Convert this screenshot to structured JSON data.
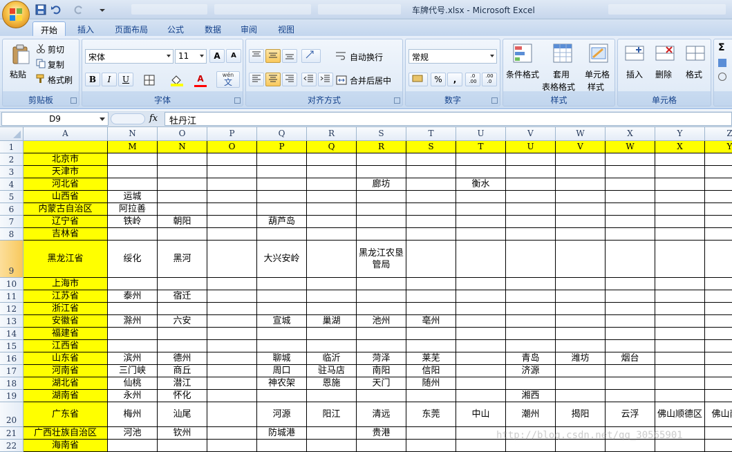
{
  "window": {
    "title": "车牌代号.xlsx - Microsoft Excel"
  },
  "ribbon_tabs": [
    "开始",
    "插入",
    "页面布局",
    "公式",
    "数据",
    "审阅",
    "视图"
  ],
  "clipboard": {
    "paste": "粘贴",
    "cut": "剪切",
    "copy": "复制",
    "format_painter": "格式刷",
    "label": "剪贴板"
  },
  "font": {
    "name": "宋体",
    "size": "11",
    "label": "字体",
    "bold": "B",
    "italic": "I",
    "underline": "U",
    "grow": "A",
    "shrink": "A",
    "font_color": "A",
    "phonetic": "wén",
    "phonetic_char": "文"
  },
  "alignment": {
    "wrap_text": "自动换行",
    "merge_center": "合并后居中",
    "label": "对齐方式"
  },
  "number": {
    "format": "常规",
    "percent": "%",
    "comma": ",",
    "inc_decimal": ".0 .00",
    "dec_decimal": ".00 .0",
    "label": "数字"
  },
  "styles": {
    "conditional": "条件格式",
    "table1": "套用",
    "table2": "表格格式",
    "cell1": "单元格",
    "cell2": "样式",
    "label": "样式"
  },
  "cells": {
    "insert": "插入",
    "delete": "删除",
    "format": "格式",
    "label": "单元格"
  },
  "editing": {
    "sum": "Σ"
  },
  "formula_bar": {
    "name_box": "D9",
    "fx": "fx",
    "content": "牡丹江"
  },
  "sheet": {
    "columns": [
      "A",
      "N",
      "O",
      "P",
      "Q",
      "R",
      "S",
      "T",
      "U",
      "V",
      "W",
      "X",
      "Y",
      "Z"
    ],
    "row1": [
      "",
      "M",
      "N",
      "O",
      "P",
      "Q",
      "R",
      "S",
      "T",
      "U",
      "V",
      "W",
      "X",
      "Y"
    ],
    "rows": [
      {
        "n": "2",
        "cells": [
          "北京市",
          "",
          "",
          "",
          "",
          "",
          "",
          "",
          "",
          "",
          "",
          "",
          "",
          ""
        ]
      },
      {
        "n": "3",
        "cells": [
          "天津市",
          "",
          "",
          "",
          "",
          "",
          "",
          "",
          "",
          "",
          "",
          "",
          "",
          ""
        ]
      },
      {
        "n": "4",
        "cells": [
          "河北省",
          "",
          "",
          "",
          "",
          "",
          "廊坊",
          "",
          "衡水",
          "",
          "",
          "",
          "",
          ""
        ]
      },
      {
        "n": "5",
        "cells": [
          "山西省",
          "运城",
          "",
          "",
          "",
          "",
          "",
          "",
          "",
          "",
          "",
          "",
          "",
          ""
        ]
      },
      {
        "n": "6",
        "cells": [
          "内蒙古自治区",
          "阿拉善",
          "",
          "",
          "",
          "",
          "",
          "",
          "",
          "",
          "",
          "",
          "",
          ""
        ]
      },
      {
        "n": "7",
        "cells": [
          "辽宁省",
          "铁岭",
          "朝阳",
          "",
          "葫芦岛",
          "",
          "",
          "",
          "",
          "",
          "",
          "",
          "",
          ""
        ]
      },
      {
        "n": "8",
        "cells": [
          "吉林省",
          "",
          "",
          "",
          "",
          "",
          "",
          "",
          "",
          "",
          "",
          "",
          "",
          ""
        ]
      },
      {
        "n": "9",
        "cells": [
          "黑龙江省",
          "绥化",
          "黑河",
          "",
          "大兴安岭",
          "",
          "黑龙江农垦管局",
          "",
          "",
          "",
          "",
          "",
          "",
          ""
        ]
      },
      {
        "n": "10",
        "cells": [
          "上海市",
          "",
          "",
          "",
          "",
          "",
          "",
          "",
          "",
          "",
          "",
          "",
          "",
          ""
        ]
      },
      {
        "n": "11",
        "cells": [
          "江苏省",
          "泰州",
          "宿迁",
          "",
          "",
          "",
          "",
          "",
          "",
          "",
          "",
          "",
          "",
          ""
        ]
      },
      {
        "n": "12",
        "cells": [
          "浙江省",
          "",
          "",
          "",
          "",
          "",
          "",
          "",
          "",
          "",
          "",
          "",
          "",
          ""
        ]
      },
      {
        "n": "13",
        "cells": [
          "安徽省",
          "滁州",
          "六安",
          "",
          "宣城",
          "巢湖",
          "池州",
          "亳州",
          "",
          "",
          "",
          "",
          "",
          ""
        ]
      },
      {
        "n": "14",
        "cells": [
          "福建省",
          "",
          "",
          "",
          "",
          "",
          "",
          "",
          "",
          "",
          "",
          "",
          "",
          ""
        ]
      },
      {
        "n": "15",
        "cells": [
          "江西省",
          "",
          "",
          "",
          "",
          "",
          "",
          "",
          "",
          "",
          "",
          "",
          "",
          ""
        ]
      },
      {
        "n": "16",
        "cells": [
          "山东省",
          "滨州",
          "德州",
          "",
          "聊城",
          "临沂",
          "菏泽",
          "莱芜",
          "",
          "青岛",
          "潍坊",
          "烟台",
          "",
          ""
        ]
      },
      {
        "n": "17",
        "cells": [
          "河南省",
          "三门峡",
          "商丘",
          "",
          "周口",
          "驻马店",
          "南阳",
          "信阳",
          "",
          "济源",
          "",
          "",
          "",
          ""
        ]
      },
      {
        "n": "18",
        "cells": [
          "湖北省",
          "仙桃",
          "潜江",
          "",
          "神农架",
          "恩施",
          "天门",
          "随州",
          "",
          "",
          "",
          "",
          "",
          ""
        ]
      },
      {
        "n": "19",
        "cells": [
          "湖南省",
          "永州",
          "怀化",
          "",
          "",
          "",
          "",
          "",
          "",
          "湘西",
          "",
          "",
          "",
          ""
        ]
      },
      {
        "n": "20",
        "cells": [
          "广东省",
          "梅州",
          "汕尾",
          "",
          "河源",
          "阳江",
          "清远",
          "东莞",
          "中山",
          "潮州",
          "揭阳",
          "云浮",
          "佛山顺德区",
          "佛山南海"
        ]
      },
      {
        "n": "21",
        "cells": [
          "广西壮族自治区",
          "河池",
          "钦州",
          "",
          "防城港",
          "",
          "贵港",
          "",
          "",
          "",
          "",
          "",
          "",
          ""
        ]
      },
      {
        "n": "22",
        "cells": [
          "海南省",
          "",
          "",
          "",
          "",
          "",
          "",
          "",
          "",
          "",
          "",
          "",
          "",
          ""
        ]
      }
    ]
  },
  "watermark": "http://blog.csdn.net/qq_30565901"
}
